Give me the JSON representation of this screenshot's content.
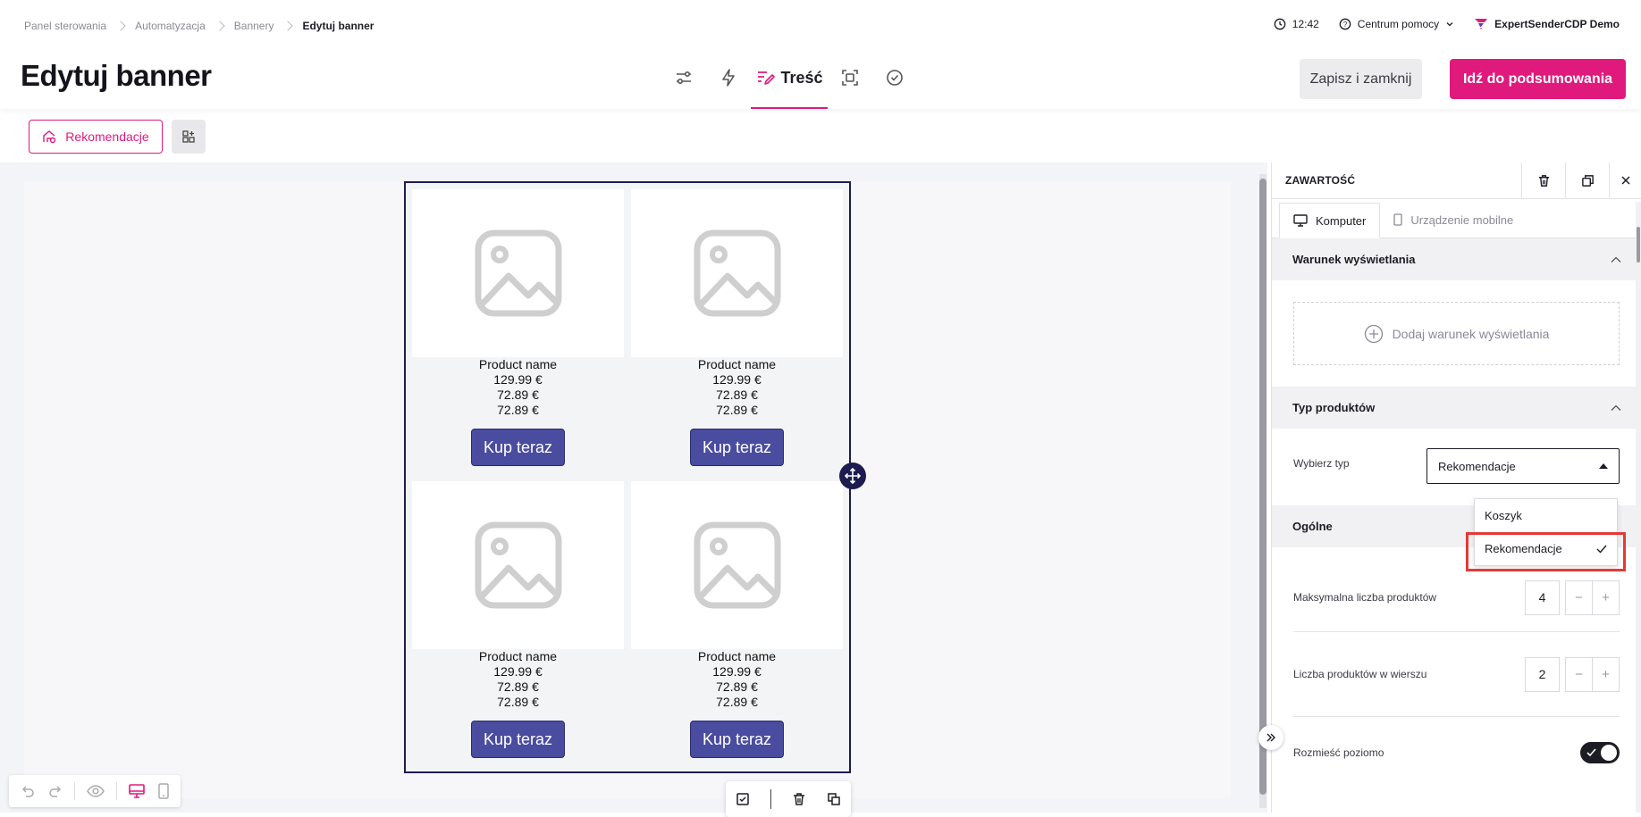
{
  "breadcrumb": [
    "Panel sterowania",
    "Automatyzacja",
    "Bannery",
    "Edytuj banner"
  ],
  "header": {
    "time": "12:42",
    "help": "Centrum pomocy",
    "account": "ExpertSenderCDP Demo",
    "title": "Edytuj banner",
    "active_step": "Treść",
    "save_label": "Zapisz i zamknij",
    "summary_label": "Idź do podsumowania"
  },
  "toolbar": {
    "recommendations_label": "Rekomendacje"
  },
  "products": [
    {
      "name": "Product name",
      "price": "129.99 €",
      "price2": "72.89 €",
      "price3": "72.89 €",
      "button": "Kup teraz"
    },
    {
      "name": "Product name",
      "price": "129.99 €",
      "price2": "72.89 €",
      "price3": "72.89 €",
      "button": "Kup teraz"
    },
    {
      "name": "Product name",
      "price": "129.99 €",
      "price2": "72.89 €",
      "price3": "72.89 €",
      "button": "Kup teraz"
    },
    {
      "name": "Product name",
      "price": "129.99 €",
      "price2": "72.89 €",
      "price3": "72.89 €",
      "button": "Kup teraz"
    }
  ],
  "panel": {
    "title": "ZAWARTOŚĆ",
    "tabs": [
      "Komputer",
      "Urządzenie mobilne"
    ],
    "display_condition": {
      "heading": "Warunek wyświetlania",
      "add_label": "Dodaj warunek wyświetlania"
    },
    "product_type": {
      "heading": "Typ produktów",
      "label": "Wybierz typ",
      "selected": "Rekomendacje",
      "options": [
        "Koszyk",
        "Rekomendacje"
      ]
    },
    "general": {
      "heading": "Ogólne",
      "max_products_label": "Maksymalna liczba produktów",
      "max_products": "4",
      "per_row_label": "Liczba produktów w wierszu",
      "per_row": "2",
      "horizontal_label": "Rozmieść poziomo"
    }
  },
  "colors": {
    "accent": "#e0197d",
    "button": "#4a4ca0",
    "frame": "#1c1c50",
    "highlight": "#e53935"
  }
}
